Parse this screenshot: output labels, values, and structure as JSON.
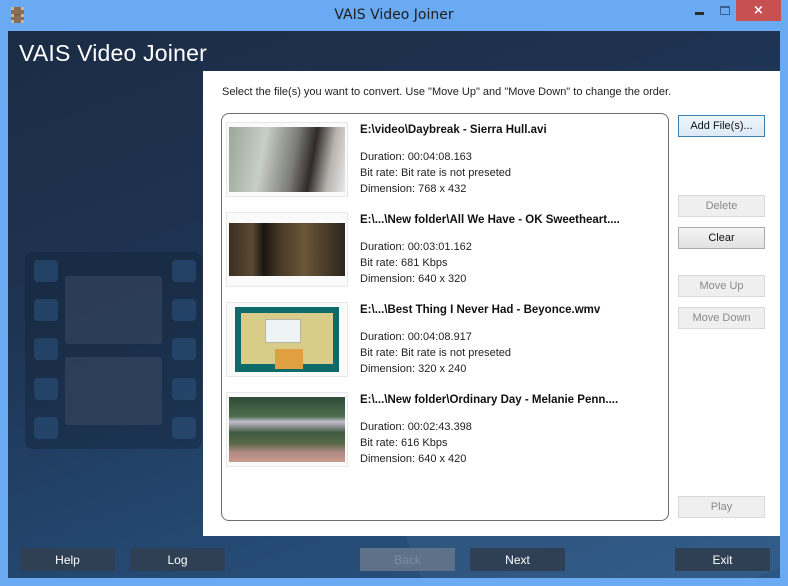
{
  "window": {
    "title": "VAIS Video Joiner",
    "controls": {
      "minimize": "minimize",
      "maximize": "maximize",
      "close": "×"
    },
    "close_color": "#c75050",
    "frame_color": "#6aaaf2"
  },
  "app": {
    "brand_title": "VAIS Video Joiner",
    "instructions": "Select the file(s) you want to convert. Use \"Move Up\" and \"Move Down\" to change the order."
  },
  "files": [
    {
      "name": "E:\\video\\Daybreak - Sierra Hull.avi",
      "duration": "Duration: 00:04:08.163",
      "bitrate": "Bit rate: Bit rate is not preseted",
      "dimension": "Dimension: 768 x 432",
      "thumbnail": "woman-by-window"
    },
    {
      "name": "E:\\...\\New folder\\All We Have - OK Sweetheart....",
      "duration": "Duration: 00:03:01.162",
      "bitrate": "Bit rate: 681 Kbps",
      "dimension": "Dimension: 640 x 320",
      "thumbnail": "dark-night-scene"
    },
    {
      "name": "E:\\...\\Best Thing I Never Had - Beyonce.wmv",
      "duration": "Duration: 00:04:08.917",
      "bitrate": "Bit rate: Bit rate is not preseted",
      "dimension": "Dimension: 320 x 240",
      "thumbnail": "drawings-on-board"
    },
    {
      "name": "E:\\...\\New folder\\Ordinary Day - Melanie Penn....",
      "duration": "Duration: 00:02:43.398",
      "bitrate": "Bit rate: 616 Kbps",
      "dimension": "Dimension: 640 x 420",
      "thumbnail": "tree-lined-street"
    }
  ],
  "side_buttons": {
    "add_files": "Add File(s)...",
    "delete": "Delete",
    "clear": "Clear",
    "move_up": "Move Up",
    "move_down": "Move Down",
    "play": "Play"
  },
  "bottom_buttons": {
    "help": "Help",
    "log": "Log",
    "back": "Back",
    "next": "Next",
    "exit": "Exit"
  }
}
